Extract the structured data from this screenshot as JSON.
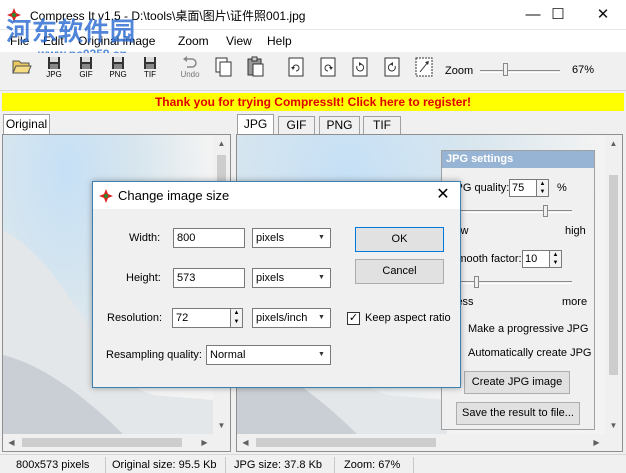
{
  "window": {
    "title": "Compress It v1.5 - D:\\tools\\桌面\\图片\\证件照001.jpg",
    "minimize_glyph": "—",
    "maximize_glyph": "☐",
    "close_glyph": "✕"
  },
  "watermark": {
    "text": "河东软件园",
    "url": "www.pc0359.cn"
  },
  "menu": [
    "File",
    "Edit",
    "Original image",
    "Zoom",
    "View",
    "Help"
  ],
  "toolbar": {
    "buttons": [
      {
        "label": "",
        "icon": "open-folder-icon"
      },
      {
        "label": "JPG",
        "icon": "floppy-icon"
      },
      {
        "label": "GIF",
        "icon": "floppy-icon"
      },
      {
        "label": "PNG",
        "icon": "floppy-icon"
      },
      {
        "label": "TIF",
        "icon": "floppy-icon"
      },
      {
        "label": "Undo",
        "icon": "undo-icon"
      },
      {
        "label": "",
        "icon": "copy-icon"
      },
      {
        "label": "",
        "icon": "paste-icon"
      },
      {
        "label": "",
        "icon": "rotate-left-icon"
      },
      {
        "label": "",
        "icon": "rotate-right-icon"
      },
      {
        "label": "",
        "icon": "rotate-ccw-icon"
      },
      {
        "label": "",
        "icon": "rotate-cw-icon"
      },
      {
        "label": "",
        "icon": "resize-icon"
      }
    ],
    "zoom_label": "Zoom",
    "zoom_value": "67%",
    "zoom_level": 0.3
  },
  "register_banner": "Thank you for trying CompressIt! Click here to register!",
  "left_tabs": [
    "Original"
  ],
  "right_tabs": [
    "JPG",
    "GIF",
    "PNG",
    "TIF"
  ],
  "jpg_settings": {
    "title": "JPG settings",
    "quality_label": "JPG quality:",
    "quality_value": "75",
    "quality_unit": "%",
    "quality_low": "low",
    "quality_high": "high",
    "smooth_label": "Smooth factor:",
    "smooth_value": "10",
    "smooth_less": "less",
    "smooth_more": "more",
    "progressive_label": "Make a progressive JPG",
    "auto_create_label": "Automatically create JPG",
    "create_button": "Create JPG image",
    "save_button": "Save the result to file..."
  },
  "dialog": {
    "title": "Change image size",
    "width_label": "Width:",
    "width_value": "800",
    "width_unit": "pixels",
    "height_label": "Height:",
    "height_value": "573",
    "height_unit": "pixels",
    "resolution_label": "Resolution:",
    "resolution_value": "72",
    "resolution_unit": "pixels/inch",
    "keep_aspect_label": "Keep aspect ratio",
    "keep_aspect_checked": true,
    "resampling_label": "Resampling quality:",
    "resampling_value": "Normal",
    "ok_label": "OK",
    "cancel_label": "Cancel",
    "close_glyph": "✕"
  },
  "status": {
    "dimensions": "800x573 pixels",
    "original_size": "Original size: 95.5 Kb",
    "jpg_size": "JPG size: 37.8 Kb",
    "zoom": "Zoom: 67%"
  }
}
